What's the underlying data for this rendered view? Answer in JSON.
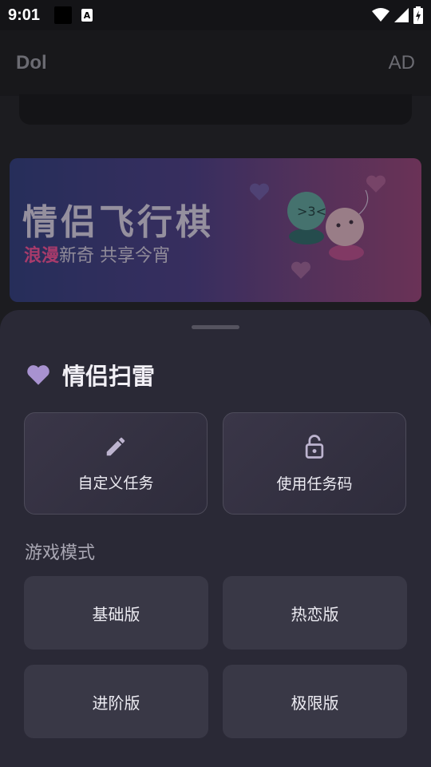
{
  "status_bar": {
    "time": "9:01",
    "icons": [
      "notification-black-icon",
      "a-notification-icon",
      "wifi-icon",
      "cell-signal-icon",
      "battery-charging-icon"
    ]
  },
  "app_bar": {
    "title": "Dol",
    "ad_label": "AD"
  },
  "banner": {
    "title": "情侣飞行棋",
    "subtitle_highlight": "浪漫",
    "subtitle_rest": "新奇 共享今宵",
    "colors": {
      "start": "#2d3a7e",
      "end": "#9a4078",
      "highlight": "#ff4f9a"
    }
  },
  "sheet": {
    "title": "情侣扫雷",
    "title_icon": "heart-icon",
    "actions": [
      {
        "label": "自定义任务",
        "icon": "pencil-icon"
      },
      {
        "label": "使用任务码",
        "icon": "lock-icon"
      }
    ],
    "modes_label": "游戏模式",
    "modes": [
      "基础版",
      "热恋版",
      "进阶版",
      "极限版"
    ]
  },
  "colors": {
    "accent_heart": "#a892d0",
    "sheet_bg": "#2a2936",
    "button_bg": "#393846"
  }
}
